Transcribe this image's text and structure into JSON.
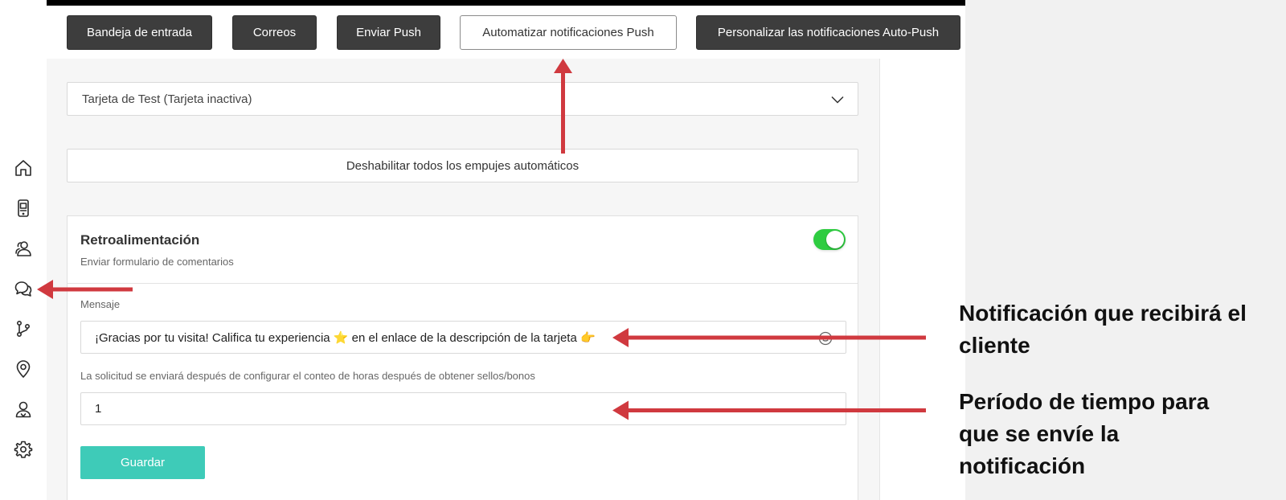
{
  "tabs": {
    "inbox": "Bandeja de entrada",
    "emails": "Correos",
    "send_push": "Enviar Push",
    "automate_push": "Automatizar notificaciones Push",
    "customize_auto_push": "Personalizar las notificaciones Auto-Push"
  },
  "card_select": {
    "value": "Tarjeta de Test (Tarjeta inactiva)"
  },
  "disable_all_label": "Deshabilitar todos los empujes automáticos",
  "feedback_card": {
    "title": "Retroalimentación",
    "subtitle": "Enviar formulario de comentarios",
    "toggle_on": true,
    "message_label": "Mensaje",
    "message_value": "¡Gracias por tu visita! Califica tu experiencia ⭐ en el enlace de la descripción de la tarjeta 👉",
    "hours_label": "La solicitud se enviará después de configurar el conteo de horas después de obtener sellos/bonos",
    "hours_value": "1",
    "save_label": "Guardar"
  },
  "annotations": {
    "note_1_line_1": "Notificación que recibirá el",
    "note_1_line_2": "cliente",
    "note_2_line_1": "Período de tiempo para",
    "note_2_line_2": "que se envíe la",
    "note_2_line_3": "notificación"
  },
  "colors": {
    "arrow": "#d0393f",
    "toggle": "#2ecc40",
    "save_button": "#3ecbb8",
    "dark_tab": "#3d3d3d"
  },
  "sidebar_icons": [
    "home-icon",
    "mobile-card-icon",
    "users-icon",
    "chat-icon",
    "branch-icon",
    "location-pin-icon",
    "user-icon",
    "settings-gear-icon"
  ]
}
